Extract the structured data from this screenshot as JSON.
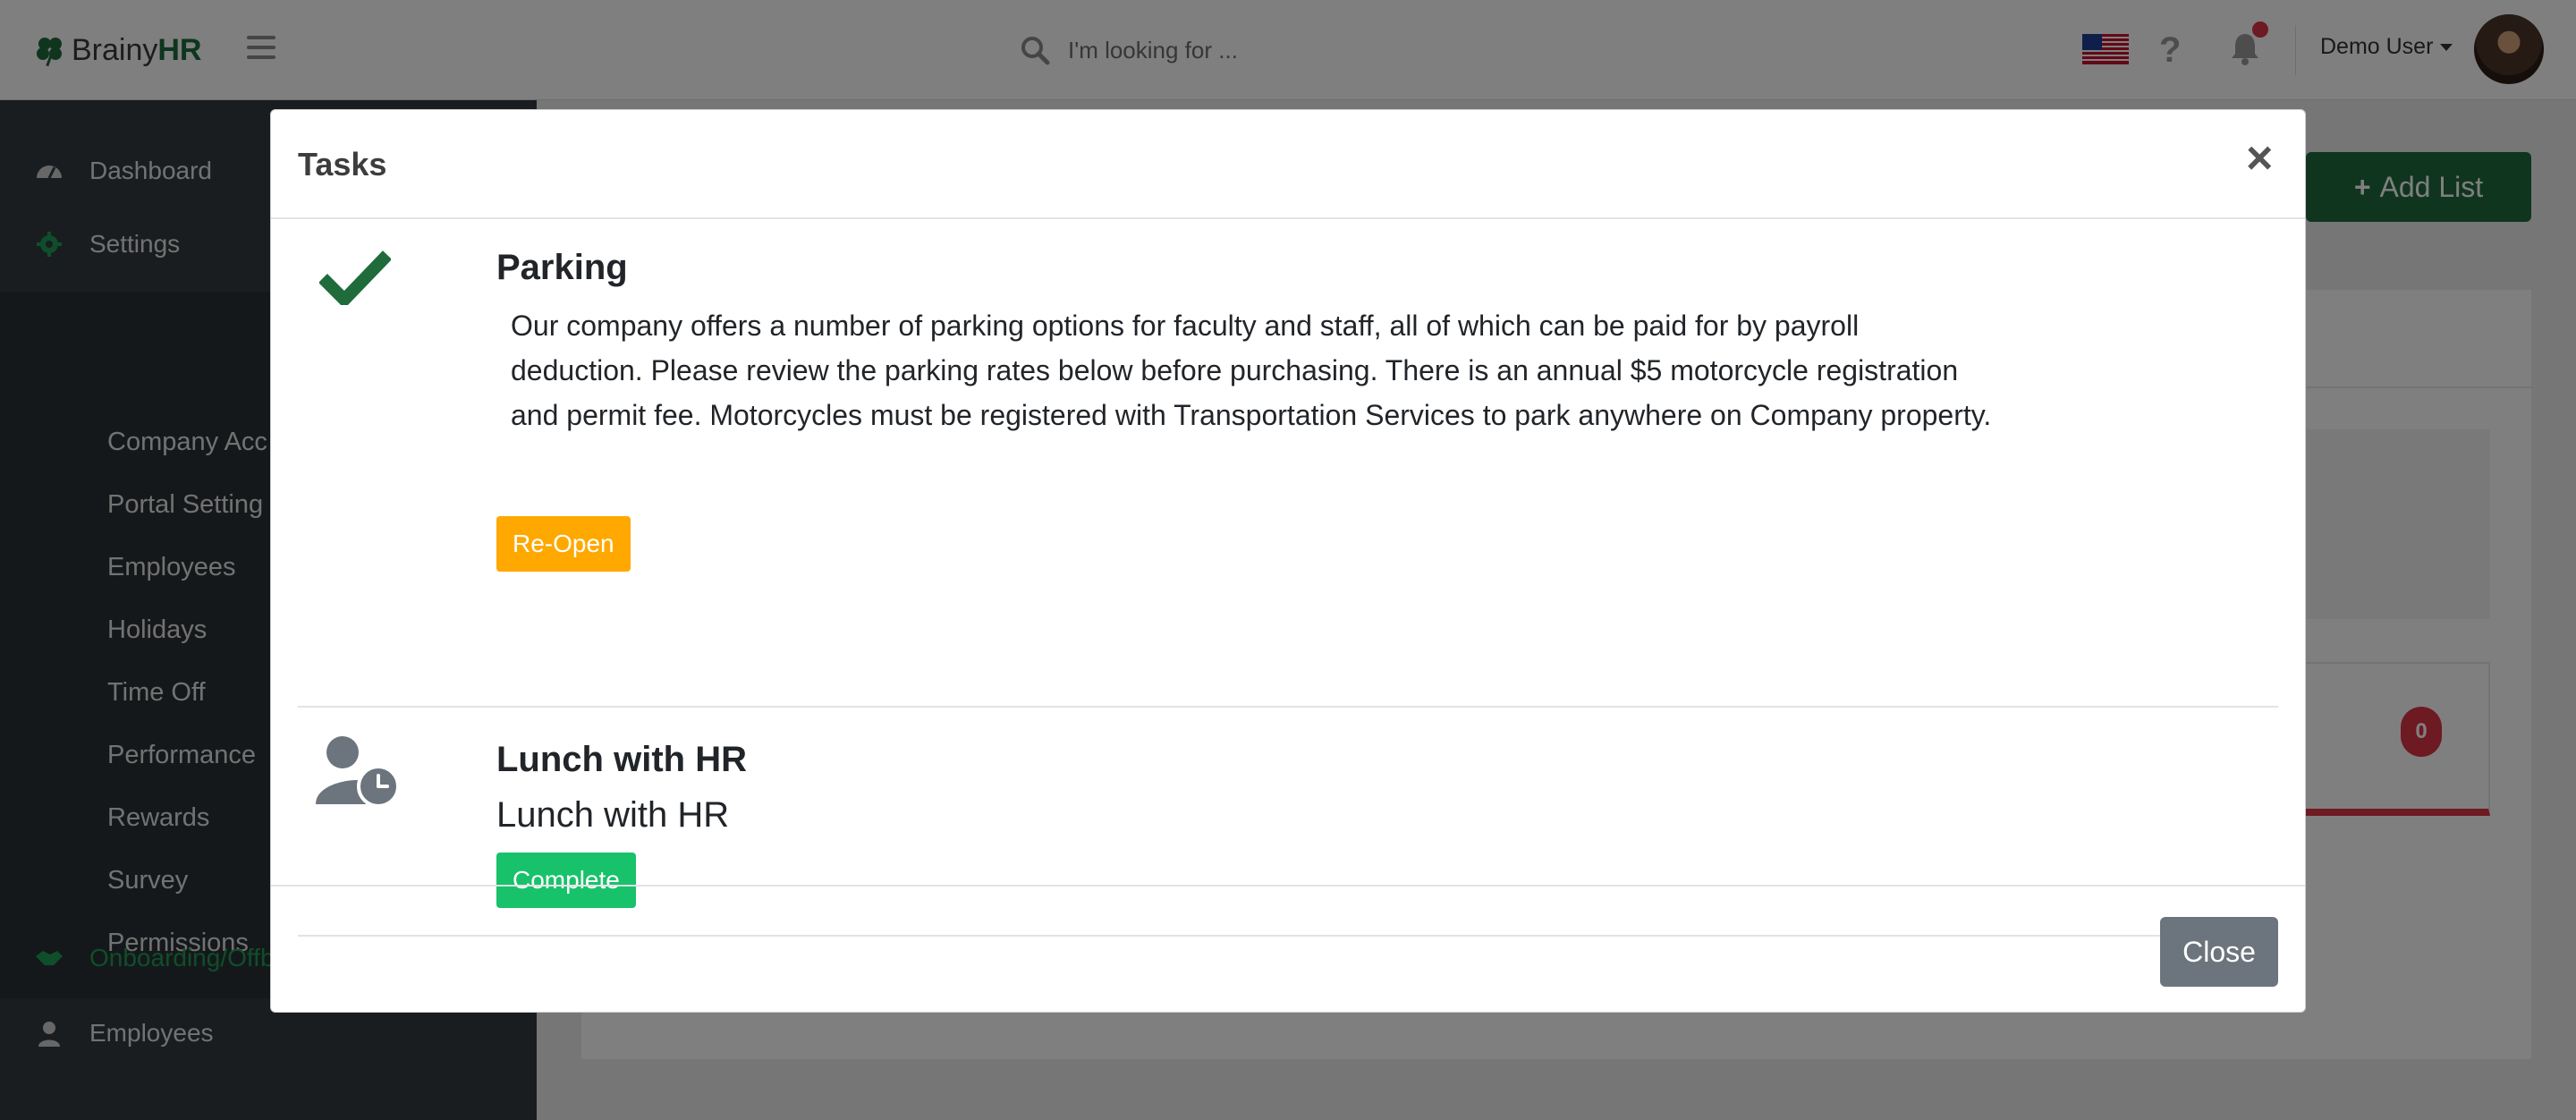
{
  "navbar": {
    "brand_light": "Brainy",
    "brand_bold": "HR",
    "search_placeholder": "I'm looking for ...",
    "help_symbol": "?",
    "user_name": "Demo User"
  },
  "sidebar": {
    "items": [
      {
        "label": "Dashboard",
        "icon": "dashboard-icon"
      },
      {
        "label": "Settings",
        "icon": "gear-icon"
      }
    ],
    "settings_submenu": [
      "Company Acc",
      "Portal Setting",
      "Employees",
      "Holidays",
      "Time Off",
      "Performance",
      "Rewards",
      "Survey",
      "Permissions"
    ],
    "lower_items": [
      {
        "label": "Onboarding/Offb",
        "icon": "handshake-icon",
        "color": "#1f9d55"
      },
      {
        "label": "Employees",
        "icon": "user-icon"
      }
    ]
  },
  "main": {
    "add_list_label": "Add List",
    "count_badge": "0"
  },
  "modal": {
    "title": "Tasks",
    "close_symbol": "×",
    "tasks": [
      {
        "title": "Parking",
        "description": "Our company offers a number of parking options for faculty and staff, all of which can be paid for by payroll deduction. Please review the parking rates below before purchasing. There is an annual $5 motorcycle registration and permit fee. Motorcycles must be registered with Transportation Services to park anywhere on Company property.",
        "status_icon": "checkmark-icon",
        "action_label": "Re-Open"
      },
      {
        "title": "Lunch with HR",
        "description": "Lunch with HR",
        "status_icon": "user-clock-icon",
        "action_label": "Complete"
      }
    ],
    "footer_close_label": "Close"
  },
  "colors": {
    "brand_green": "#1f6b3c",
    "sidebar_bg": "#343a40",
    "reopen": "#ffa800",
    "complete": "#17c26b",
    "close_button": "#6c757d",
    "badge_red": "#dc3545"
  }
}
